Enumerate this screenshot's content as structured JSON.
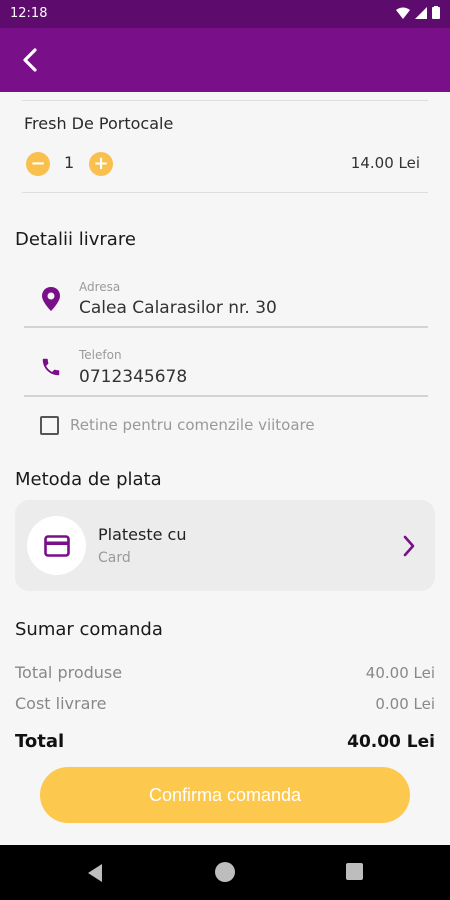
{
  "status_bar": {
    "time": "12:18"
  },
  "product": {
    "name": "Fresh De Portocale",
    "quantity": "1",
    "minus_label": "−",
    "plus_label": "+",
    "price": "14.00 Lei"
  },
  "delivery": {
    "title": "Detalii livrare",
    "address_label": "Adresa",
    "address_value": "Calea Calarasilor nr. 30",
    "phone_label": "Telefon",
    "phone_value": "0712345678",
    "remember_label": "Retine pentru comenzile viitoare"
  },
  "payment": {
    "title": "Metoda de plata",
    "option_title": "Plateste cu",
    "option_sub": "Card"
  },
  "summary": {
    "title": "Sumar comanda",
    "products_label": "Total produse",
    "products_value": "40.00 Lei",
    "delivery_label": "Cost livrare",
    "delivery_value": "0.00 Lei",
    "total_label": "Total",
    "total_value": "40.00 Lei"
  },
  "confirm_label": "Confirma comanda",
  "colors": {
    "brand_purple": "#7a0f8a",
    "accent_yellow": "#fcc94e"
  }
}
